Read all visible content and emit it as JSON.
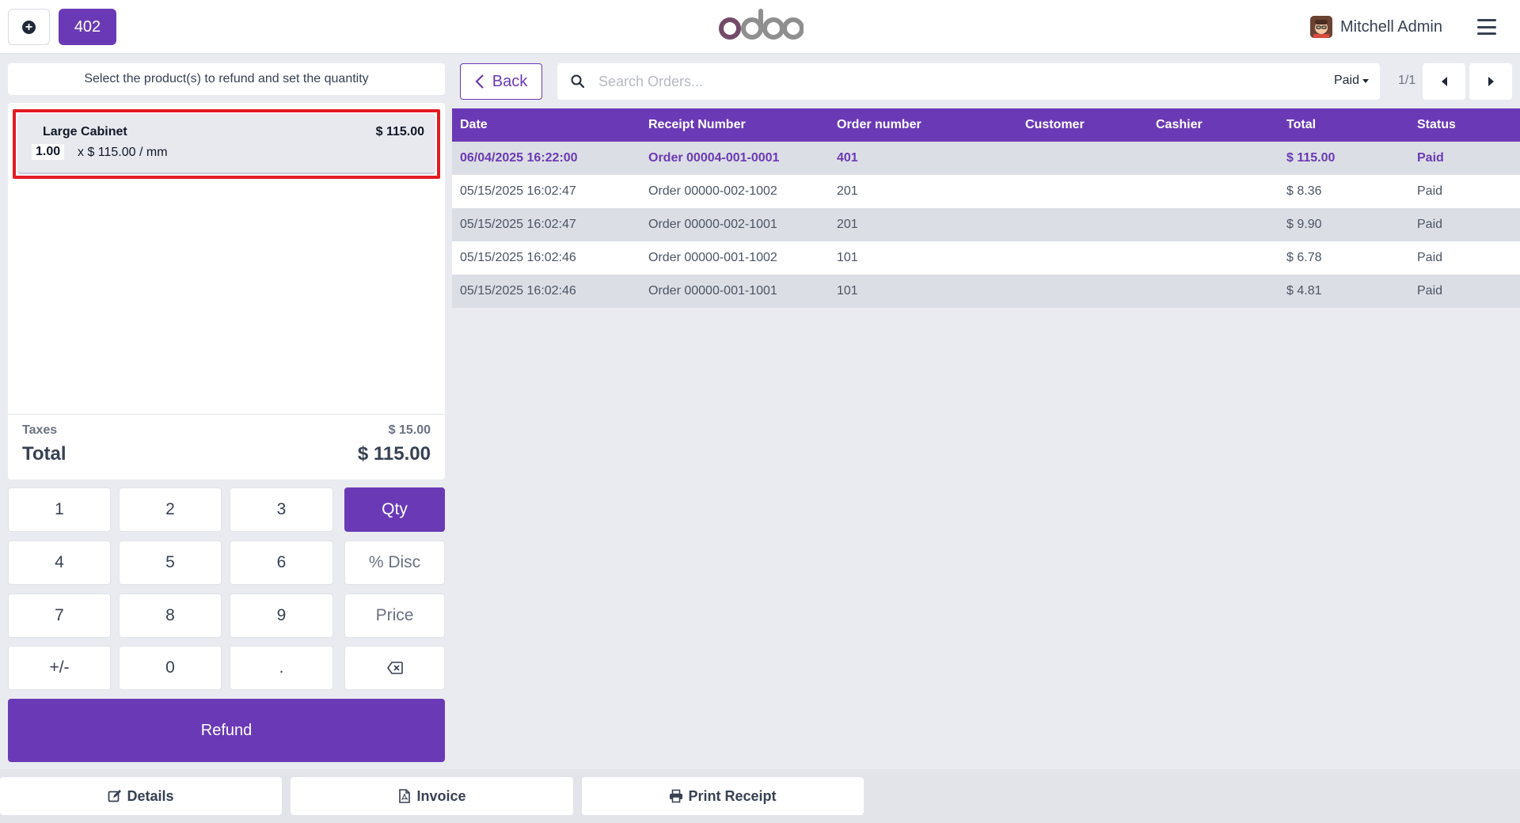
{
  "header": {
    "order_number": "402",
    "logo_text": "odoo",
    "user_name": "Mitchell Admin"
  },
  "left": {
    "instruction": "Select the product(s) to refund and set the quantity",
    "orderline": {
      "name": "Large Cabinet",
      "price": "$ 115.00",
      "qty": "1.00",
      "unit_price": "x $ 115.00 / mm"
    },
    "taxes_label": "Taxes",
    "taxes_value": "$ 15.00",
    "total_label": "Total",
    "total_value": "$ 115.00"
  },
  "numpad": {
    "keys": [
      "1",
      "2",
      "3",
      "4",
      "5",
      "6",
      "7",
      "8",
      "9",
      "+/-",
      "0",
      "."
    ],
    "modes": [
      "Qty",
      "% Disc",
      "Price"
    ],
    "active_mode": "Qty",
    "refund_label": "Refund"
  },
  "search": {
    "back_label": "Back",
    "placeholder": "Search Orders...",
    "filter_label": "Paid",
    "page_count": "1/1"
  },
  "table": {
    "headers": [
      "Date",
      "Receipt Number",
      "Order number",
      "Customer",
      "Cashier",
      "Total",
      "Status"
    ],
    "rows": [
      {
        "date": "06/04/2025 16:22:00",
        "receipt": "Order 00004-001-0001",
        "order": "401",
        "customer": "",
        "cashier": "",
        "total": "$ 115.00",
        "status": "Paid"
      },
      {
        "date": "05/15/2025 16:02:47",
        "receipt": "Order 00000-002-1002",
        "order": "201",
        "customer": "",
        "cashier": "",
        "total": "$ 8.36",
        "status": "Paid"
      },
      {
        "date": "05/15/2025 16:02:47",
        "receipt": "Order 00000-002-1001",
        "order": "201",
        "customer": "",
        "cashier": "",
        "total": "$ 9.90",
        "status": "Paid"
      },
      {
        "date": "05/15/2025 16:02:46",
        "receipt": "Order 00000-001-1002",
        "order": "101",
        "customer": "",
        "cashier": "",
        "total": "$ 6.78",
        "status": "Paid"
      },
      {
        "date": "05/15/2025 16:02:46",
        "receipt": "Order 00000-001-1001",
        "order": "101",
        "customer": "",
        "cashier": "",
        "total": "$ 4.81",
        "status": "Paid"
      }
    ]
  },
  "footer": {
    "details_label": "Details",
    "invoice_label": "Invoice",
    "print_label": "Print Receipt"
  },
  "colors": {
    "accent": "#6a3ab6",
    "selection_border": "#e31b23"
  }
}
